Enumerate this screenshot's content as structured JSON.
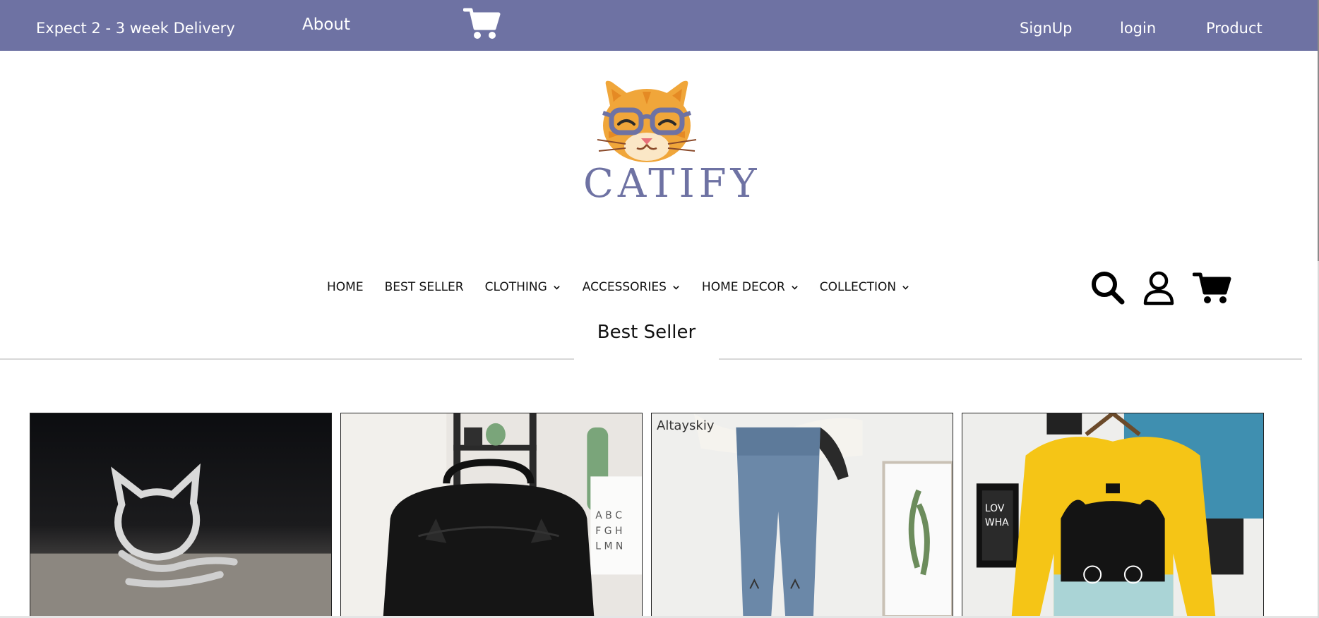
{
  "topbar": {
    "delivery_text": "Expect 2 - 3 week Delivery",
    "about_label": "About",
    "cart_icon": "cart-icon",
    "signup_label": "SignUp",
    "login_label": "login",
    "product_label": "Product",
    "background_color": "#6e72a3"
  },
  "brand": {
    "name": "CATIFY",
    "logo_icon": "cat-with-glasses-logo",
    "brand_color": "#6e72a3",
    "accent_color": "#f0a63a"
  },
  "nav": {
    "items": [
      {
        "label": "HOME",
        "has_dropdown": false
      },
      {
        "label": "BEST SELLER",
        "has_dropdown": false
      },
      {
        "label": "CLOTHING",
        "has_dropdown": true
      },
      {
        "label": "ACCESSORIES",
        "has_dropdown": true
      },
      {
        "label": "HOME DECOR",
        "has_dropdown": true
      },
      {
        "label": "COLLECTION",
        "has_dropdown": true
      }
    ],
    "icons": [
      "search-icon",
      "user-icon",
      "cart-icon"
    ]
  },
  "section": {
    "title": "Best Seller"
  },
  "products": [
    {
      "image": "silver-cat-ring"
    },
    {
      "image": "black-cat-ear-backpack"
    },
    {
      "image": "cat-embroidered-jeans",
      "watermark": "Altayskiy"
    },
    {
      "image": "yellow-cat-sweater"
    }
  ]
}
